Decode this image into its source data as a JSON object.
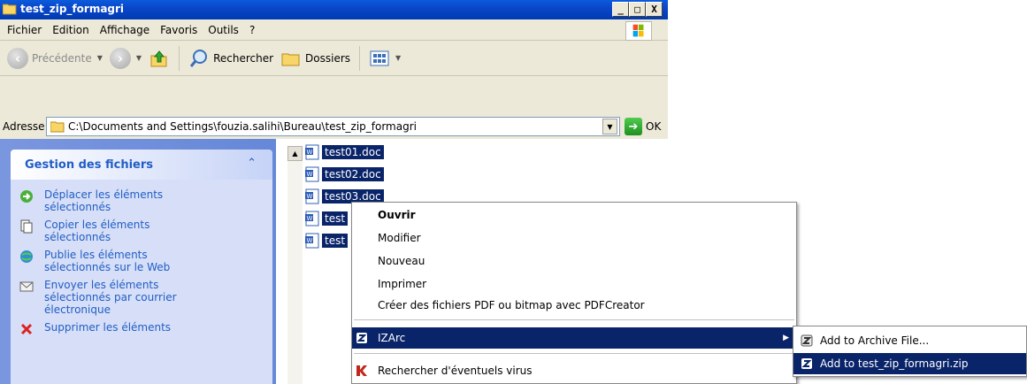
{
  "window": {
    "title": "test_zip_formagri",
    "min_glyph": "_",
    "max_glyph": "□",
    "close_glyph": "X"
  },
  "menubar": {
    "items": [
      "Fichier",
      "Edition",
      "Affichage",
      "Favoris",
      "Outils",
      "?"
    ]
  },
  "toolbar": {
    "back_label": "Précédente",
    "search_label": "Rechercher",
    "folders_label": "Dossiers"
  },
  "address": {
    "label": "Adresse",
    "path": "C:\\Documents and Settings\\fouzia.salihi\\Bureau\\test_zip_formagri",
    "go_label": "OK"
  },
  "tasks": {
    "title": "Gestion des fichiers",
    "collapse_glyph": "⌃",
    "items": [
      {
        "label": "Déplacer les éléments sélectionnés",
        "icon": "move-icon"
      },
      {
        "label": "Copier les éléments sélectionnés",
        "icon": "copy-icon"
      },
      {
        "label": "Publie les éléments sélectionnés sur le Web",
        "icon": "web-publish-icon"
      },
      {
        "label": "Envoyer les éléments sélectionnés par courrier électronique",
        "icon": "email-icon"
      },
      {
        "label": "Supprimer les éléments",
        "icon": "delete-icon"
      }
    ]
  },
  "files": [
    "test01.doc",
    "test02.doc",
    "test03.doc",
    "test",
    "test"
  ],
  "context_menu": {
    "items": [
      "Ouvrir",
      "Modifier",
      "Nouveau",
      "Imprimer",
      "Créer des fichiers PDF ou bitmap avec PDFCreator"
    ],
    "izarc": "IZArc",
    "virus": "Rechercher d'éventuels virus"
  },
  "submenu": {
    "items": [
      "Add to Archive File...",
      "Add to test_zip_formagri.zip"
    ]
  },
  "colors": {
    "selection": "#0a246a",
    "titlebar": "#0a46c8",
    "task_link": "#215dc6"
  }
}
